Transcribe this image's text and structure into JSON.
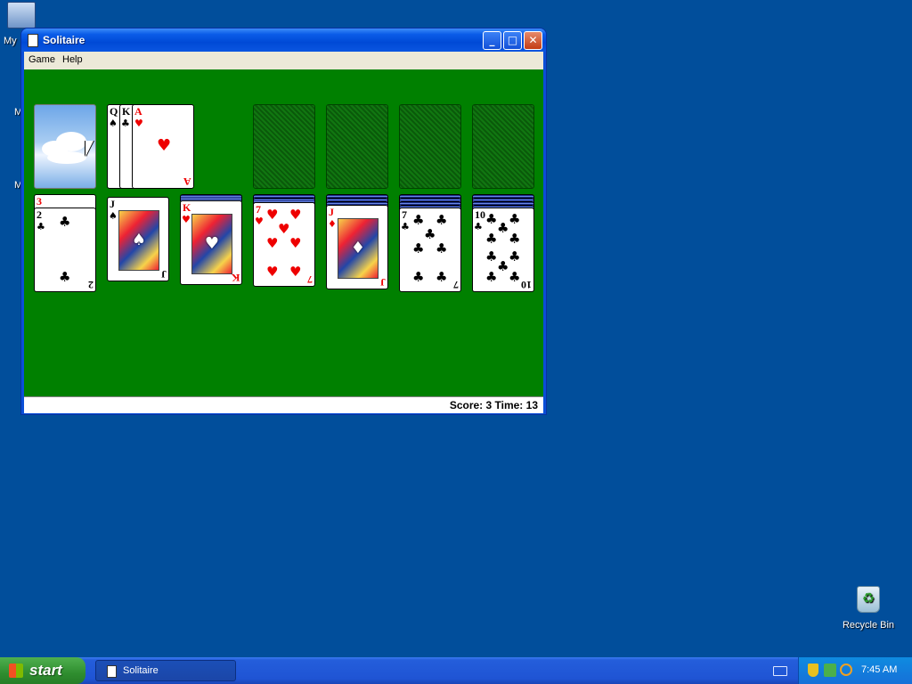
{
  "desktop": {
    "icons": [
      {
        "label": "My"
      },
      {
        "label": "Recycle Bin"
      }
    ]
  },
  "window": {
    "title": "Solitaire",
    "menus": [
      "Game",
      "Help"
    ],
    "status": "Score: 3 Time: 13"
  },
  "game": {
    "waste": [
      {
        "rank": "Q",
        "suit": "♠"
      },
      {
        "rank": "K",
        "suit": "♣"
      },
      {
        "rank": "A",
        "suit": "♥"
      }
    ],
    "tableau": [
      {
        "hidden_rank": "3",
        "rank": "2",
        "suit": "♣"
      },
      {
        "rank": "J",
        "suit": "♠"
      },
      {
        "rank": "K",
        "suit": "♥"
      },
      {
        "rank": "7",
        "suit": "♥"
      },
      {
        "rank": "J",
        "suit": "♦"
      },
      {
        "rank": "7",
        "suit": "♣"
      },
      {
        "rank": "10",
        "suit": "♣"
      }
    ]
  },
  "taskbar": {
    "start_label": "start",
    "task_label": "Solitaire",
    "clock": "7:45 AM"
  }
}
